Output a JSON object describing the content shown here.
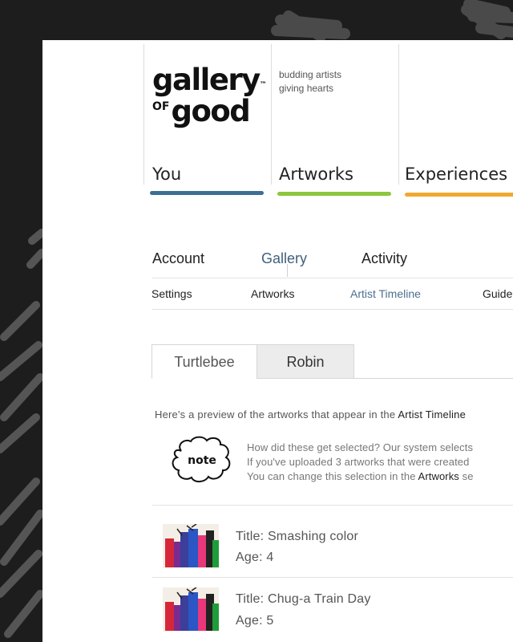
{
  "brand": {
    "logo_line1": "gallery",
    "logo_tm": "™",
    "logo_of": "OF",
    "logo_good": "good",
    "tagline_line1": "budding artists",
    "tagline_line2": "giving hearts"
  },
  "sections": [
    {
      "label": "You",
      "underline_color": "#3d6e93"
    },
    {
      "label": "Artworks",
      "underline_color": "#8dc63f"
    },
    {
      "label": "Experiences",
      "underline_color": "#f0a830"
    }
  ],
  "main_menu": [
    {
      "label": "Account",
      "active": false
    },
    {
      "label": "Gallery",
      "active": true
    },
    {
      "label": "Activity",
      "active": false
    }
  ],
  "sub_menu": [
    {
      "label": "Settings",
      "active": false
    },
    {
      "label": "Artworks",
      "active": false
    },
    {
      "label": "Artist Timeline",
      "active": true
    },
    {
      "label": "Guide",
      "active": false
    }
  ],
  "artist_tabs": [
    {
      "label": "Turtlebee",
      "active": true
    },
    {
      "label": "Robin",
      "active": false
    }
  ],
  "intro": {
    "text": "Here's a preview of the artworks that appear in the ",
    "link": "Artist Timeline"
  },
  "note": {
    "badge": "note",
    "line1": "How did these get selected? Our system selects",
    "line2": "If you've uploaded 3 artworks that were created",
    "line3_prefix": "You can change this selection in the ",
    "line3_link": "Artworks",
    "line3_suffix": " se"
  },
  "artworks": [
    {
      "title_label": "Title:",
      "title": "Smashing color",
      "age_label": "Age:",
      "age": "4"
    },
    {
      "title_label": "Title:",
      "title": "Chug-a Train Day",
      "age_label": "Age:",
      "age": "5"
    }
  ],
  "colors": {
    "background": "#1d1d1d",
    "active_link": "#41607d",
    "you_underline": "#3d6e93",
    "artworks_underline": "#8dc63f",
    "experiences_underline": "#f0a830"
  }
}
